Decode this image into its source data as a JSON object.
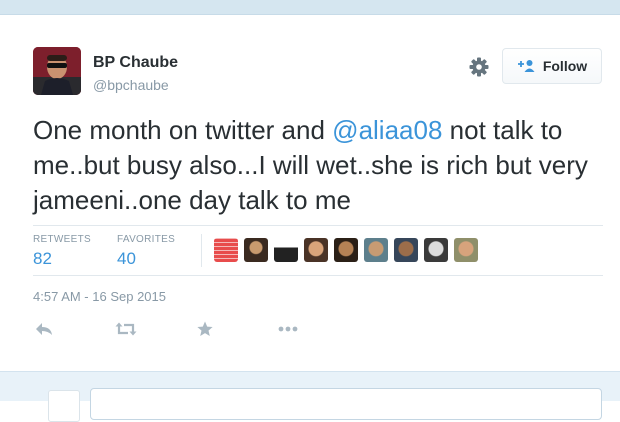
{
  "user": {
    "display_name": "BP Chaube",
    "screen_name": "@bpchaube"
  },
  "header": {
    "follow_label": "Follow",
    "settings_icon": "gear-icon"
  },
  "tweet": {
    "text_before": "One month on twitter and ",
    "mention": "@aliaa08",
    "text_after": " not talk to me..but busy also...I will wet..she is rich but very jameeni..one day talk to me"
  },
  "stats": {
    "retweets_label": "RETWEETS",
    "retweets_value": "82",
    "favorites_label": "FAVORITES",
    "favorites_value": "40"
  },
  "timestamp": "4:57 AM - 16 Sep 2015",
  "actions": [
    "reply-icon",
    "retweet-icon",
    "favorite-star-icon",
    "more-dots-icon"
  ],
  "colors": {
    "link": "#3b94d9",
    "muted": "#8899a6",
    "text": "#292f33",
    "border": "#e1e8ed"
  }
}
